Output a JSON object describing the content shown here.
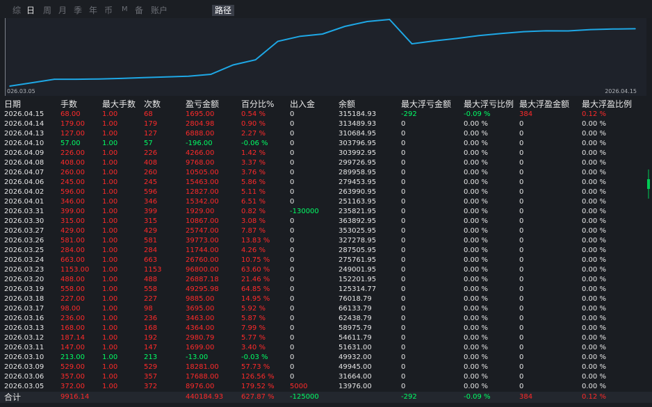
{
  "tabs": [
    "综",
    "日",
    "周",
    "月",
    "季",
    "年",
    "币",
    "M",
    "备",
    "账户",
    "路径"
  ],
  "active_tab": "日",
  "selected_view": "路径",
  "colors": {
    "line": "#1ea8e6",
    "up": "#ff2a2a",
    "down": "#00ff66",
    "text": "#e6e6e6",
    "bg": "#1a1d22"
  },
  "chart_data": {
    "type": "line",
    "x": [
      "2026.03.05",
      "2026.03.06",
      "2026.03.09",
      "2026.03.10",
      "2026.03.11",
      "2026.03.12",
      "2026.03.13",
      "2026.03.16",
      "2026.03.17",
      "2026.03.18",
      "2026.03.19",
      "2026.03.20",
      "2026.03.23",
      "2026.03.24",
      "2026.03.25",
      "2026.03.26",
      "2026.03.27",
      "2026.03.30",
      "2026.03.31",
      "2026.04.01",
      "2026.04.02",
      "2026.04.06",
      "2026.04.07",
      "2026.04.08",
      "2026.04.09",
      "2026.04.10",
      "2026.04.13",
      "2026.04.14",
      "2026.04.15"
    ],
    "series": [
      {
        "values": [
          13976.0,
          31664.0,
          49945.0,
          49932.0,
          51631.0,
          54611.79,
          58975.79,
          62438.79,
          66133.79,
          76018.79,
          125314.77,
          152201.95,
          249001.95,
          275761.95,
          287505.95,
          327278.95,
          353025.95,
          363892.95,
          235821.95,
          251163.95,
          263990.95,
          279453.95,
          289958.95,
          299726.95,
          303992.95,
          303796.95,
          310684.95,
          313489.93,
          315184.93
        ]
      }
    ],
    "x_start_label": "026.03.05",
    "x_end_label": "2026.04.15",
    "grid": false
  },
  "table": {
    "headers": [
      "日期",
      "手数",
      "最大手数",
      "次数",
      "盈亏金额",
      "百分比%",
      "出入金",
      "余额",
      "最大浮亏金额",
      "最大浮亏比例",
      "最大浮盈金额",
      "最大浮盈比例"
    ],
    "rows": [
      [
        "2026.04.15",
        "68.00",
        "1.00",
        "68",
        "1695.00",
        "0.54 %",
        "0",
        "315184.93",
        "-292",
        "-0.09 %",
        "384",
        "0.12 %"
      ],
      [
        "2026.04.14",
        "179.00",
        "1.00",
        "179",
        "2804.98",
        "0.90 %",
        "0",
        "313489.93",
        "0",
        "0.00 %",
        "0",
        "0.00 %"
      ],
      [
        "2026.04.13",
        "127.00",
        "1.00",
        "127",
        "6888.00",
        "2.27 %",
        "0",
        "310684.95",
        "0",
        "0.00 %",
        "0",
        "0.00 %"
      ],
      [
        "2026.04.10",
        "57.00",
        "1.00",
        "57",
        "-196.00",
        "-0.06 %",
        "0",
        "303796.95",
        "0",
        "0.00 %",
        "0",
        "0.00 %"
      ],
      [
        "2026.04.09",
        "226.00",
        "1.00",
        "226",
        "4266.00",
        "1.42 %",
        "0",
        "303992.95",
        "0",
        "0.00 %",
        "0",
        "0.00 %"
      ],
      [
        "2026.04.08",
        "408.00",
        "1.00",
        "408",
        "9768.00",
        "3.37 %",
        "0",
        "299726.95",
        "0",
        "0.00 %",
        "0",
        "0.00 %"
      ],
      [
        "2026.04.07",
        "260.00",
        "1.00",
        "260",
        "10505.00",
        "3.76 %",
        "0",
        "289958.95",
        "0",
        "0.00 %",
        "0",
        "0.00 %"
      ],
      [
        "2026.04.06",
        "245.00",
        "1.00",
        "245",
        "15463.00",
        "5.86 %",
        "0",
        "279453.95",
        "0",
        "0.00 %",
        "0",
        "0.00 %"
      ],
      [
        "2026.04.02",
        "596.00",
        "1.00",
        "596",
        "12827.00",
        "5.11 %",
        "0",
        "263990.95",
        "0",
        "0.00 %",
        "0",
        "0.00 %"
      ],
      [
        "2026.04.01",
        "346.00",
        "1.00",
        "346",
        "15342.00",
        "6.51 %",
        "0",
        "251163.95",
        "0",
        "0.00 %",
        "0",
        "0.00 %"
      ],
      [
        "2026.03.31",
        "399.00",
        "1.00",
        "399",
        "1929.00",
        "0.82 %",
        "-130000",
        "235821.95",
        "0",
        "0.00 %",
        "0",
        "0.00 %"
      ],
      [
        "2026.03.30",
        "315.00",
        "1.00",
        "315",
        "10867.00",
        "3.08 %",
        "0",
        "363892.95",
        "0",
        "0.00 %",
        "0",
        "0.00 %"
      ],
      [
        "2026.03.27",
        "429.00",
        "1.00",
        "429",
        "25747.00",
        "7.87 %",
        "0",
        "353025.95",
        "0",
        "0.00 %",
        "0",
        "0.00 %"
      ],
      [
        "2026.03.26",
        "581.00",
        "1.00",
        "581",
        "39773.00",
        "13.83 %",
        "0",
        "327278.95",
        "0",
        "0.00 %",
        "0",
        "0.00 %"
      ],
      [
        "2026.03.25",
        "284.00",
        "1.00",
        "284",
        "11744.00",
        "4.26 %",
        "0",
        "287505.95",
        "0",
        "0.00 %",
        "0",
        "0.00 %"
      ],
      [
        "2026.03.24",
        "663.00",
        "1.00",
        "663",
        "26760.00",
        "10.75 %",
        "0",
        "275761.95",
        "0",
        "0.00 %",
        "0",
        "0.00 %"
      ],
      [
        "2026.03.23",
        "1153.00",
        "1.00",
        "1153",
        "96800.00",
        "63.60 %",
        "0",
        "249001.95",
        "0",
        "0.00 %",
        "0",
        "0.00 %"
      ],
      [
        "2026.03.20",
        "488.00",
        "1.00",
        "488",
        "26887.18",
        "21.46 %",
        "0",
        "152201.95",
        "0",
        "0.00 %",
        "0",
        "0.00 %"
      ],
      [
        "2026.03.19",
        "558.00",
        "1.00",
        "558",
        "49295.98",
        "64.85 %",
        "0",
        "125314.77",
        "0",
        "0.00 %",
        "0",
        "0.00 %"
      ],
      [
        "2026.03.18",
        "227.00",
        "1.00",
        "227",
        "9885.00",
        "14.95 %",
        "0",
        "76018.79",
        "0",
        "0.00 %",
        "0",
        "0.00 %"
      ],
      [
        "2026.03.17",
        "98.00",
        "1.00",
        "98",
        "3695.00",
        "5.92 %",
        "0",
        "66133.79",
        "0",
        "0.00 %",
        "0",
        "0.00 %"
      ],
      [
        "2026.03.16",
        "236.00",
        "1.00",
        "236",
        "3463.00",
        "5.87 %",
        "0",
        "62438.79",
        "0",
        "0.00 %",
        "0",
        "0.00 %"
      ],
      [
        "2026.03.13",
        "168.00",
        "1.00",
        "168",
        "4364.00",
        "7.99 %",
        "0",
        "58975.79",
        "0",
        "0.00 %",
        "0",
        "0.00 %"
      ],
      [
        "2026.03.12",
        "187.14",
        "1.00",
        "192",
        "2980.79",
        "5.77 %",
        "0",
        "54611.79",
        "0",
        "0.00 %",
        "0",
        "0.00 %"
      ],
      [
        "2026.03.11",
        "147.00",
        "1.00",
        "147",
        "1699.00",
        "3.40 %",
        "0",
        "51631.00",
        "0",
        "0.00 %",
        "0",
        "0.00 %"
      ],
      [
        "2026.03.10",
        "213.00",
        "1.00",
        "213",
        "-13.00",
        "-0.03 %",
        "0",
        "49932.00",
        "0",
        "0.00 %",
        "0",
        "0.00 %"
      ],
      [
        "2026.03.09",
        "529.00",
        "1.00",
        "529",
        "18281.00",
        "57.73 %",
        "0",
        "49945.00",
        "0",
        "0.00 %",
        "0",
        "0.00 %"
      ],
      [
        "2026.03.06",
        "357.00",
        "1.00",
        "357",
        "17688.00",
        "126.56 %",
        "0",
        "31664.00",
        "0",
        "0.00 %",
        "0",
        "0.00 %"
      ],
      [
        "2026.03.05",
        "372.00",
        "1.00",
        "372",
        "8976.00",
        "179.52 %",
        "5000",
        "13976.00",
        "0",
        "0.00 %",
        "0",
        "0.00 %"
      ]
    ],
    "total": [
      "合计",
      "9916.14",
      "",
      "",
      "440184.93",
      "627.87 %",
      "-125000",
      "",
      "-292",
      "-0.09 %",
      "384",
      "0.12 %"
    ]
  }
}
